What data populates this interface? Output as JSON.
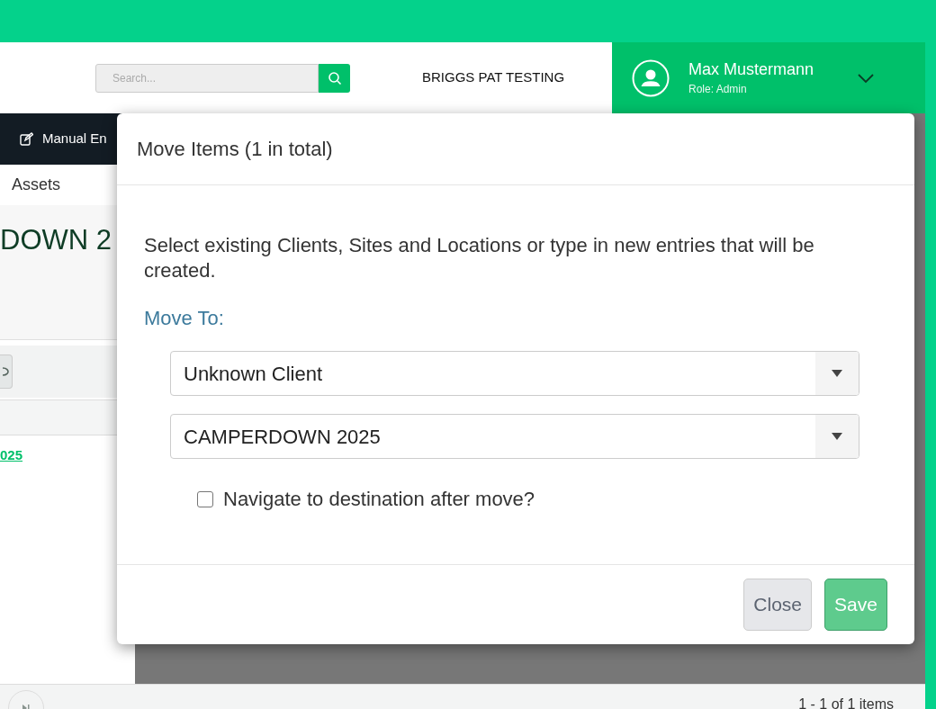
{
  "header": {
    "search": {
      "placeholder": "Search..."
    },
    "company": "BRIGGS PAT TESTING",
    "user": {
      "name": "Max Mustermann",
      "role": "Role: Admin"
    }
  },
  "nav": {
    "items": [
      {
        "label": "Manual En"
      }
    ]
  },
  "page": {
    "breadcrumb": "Assets",
    "title": "DOWN 2",
    "link": "025",
    "pager": "1 - 1 of 1 items"
  },
  "dialog": {
    "title": "Move Items (1 in total)",
    "instructions": "Select existing Clients, Sites and Locations or type in new entries that will be created.",
    "section": "Move To:",
    "selects": [
      {
        "value": "Unknown Client"
      },
      {
        "value": "CAMPERDOWN 2025"
      }
    ],
    "checkbox": {
      "label": "Navigate to destination after move?",
      "checked": false
    },
    "buttons": [
      {
        "label": "Close",
        "kind": "secondary"
      },
      {
        "label": "Save",
        "kind": "primary"
      }
    ]
  }
}
